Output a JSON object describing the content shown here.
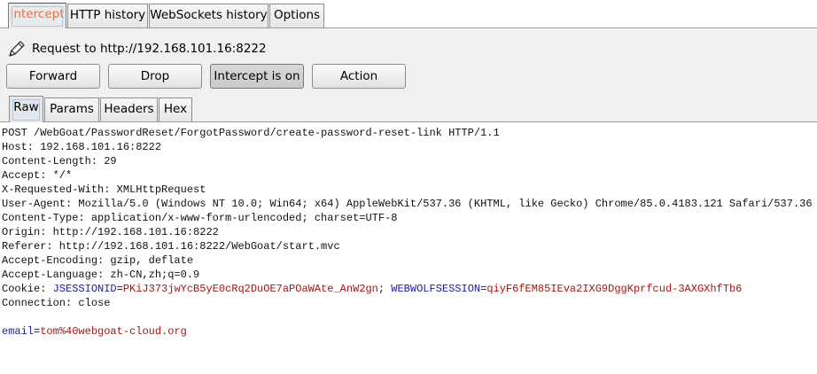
{
  "top_tabs": [
    "Intercept",
    "HTTP history",
    "WebSockets history",
    "Options"
  ],
  "request_label": "Request to http://192.168.101.16:8222",
  "buttons": {
    "forward": "Forward",
    "drop": "Drop",
    "intercept": "Intercept is on",
    "action": "Action"
  },
  "sub_tabs": [
    "Raw",
    "Params",
    "Headers",
    "Hex"
  ],
  "request": {
    "lines": [
      "POST /WebGoat/PasswordReset/ForgotPassword/create-password-reset-link HTTP/1.1",
      "Host: 192.168.101.16:8222",
      "Content-Length: 29",
      "Accept: */*",
      "X-Requested-With: XMLHttpRequest",
      "User-Agent: Mozilla/5.0 (Windows NT 10.0; Win64; x64) AppleWebKit/537.36 (KHTML, like Gecko) Chrome/85.0.4183.121 Safari/537.36",
      "Content-Type: application/x-www-form-urlencoded; charset=UTF-8",
      "Origin: http://192.168.101.16:8222",
      "Referer: http://192.168.101.16:8222/WebGoat/start.mvc",
      "Accept-Encoding: gzip, deflate",
      "Accept-Language: zh-CN,zh;q=0.9"
    ],
    "cookie": {
      "prefix": "Cookie: ",
      "name1": "JSESSIONID",
      "eq1": "=",
      "value1": "PKiJ373jwYcB5yE0cRq2DuOE7aPOaWAte_AnW2gn",
      "sep": "; ",
      "name2": "WEBWOLFSESSION",
      "eq2": "=",
      "value2": "qiyF6fEM85IEva2IXG9DggKprfcud-3AXGXhfTb6"
    },
    "connection": "Connection: close",
    "body": {
      "name": "email",
      "eq": "=",
      "value": "tom%40webgoat-cloud.org"
    }
  },
  "colors": {
    "active_tab_text": "#ff6633",
    "param_name": "#1a1aa6",
    "param_value": "#a11515"
  },
  "icons": {
    "request_icon": "pencil-icon"
  }
}
